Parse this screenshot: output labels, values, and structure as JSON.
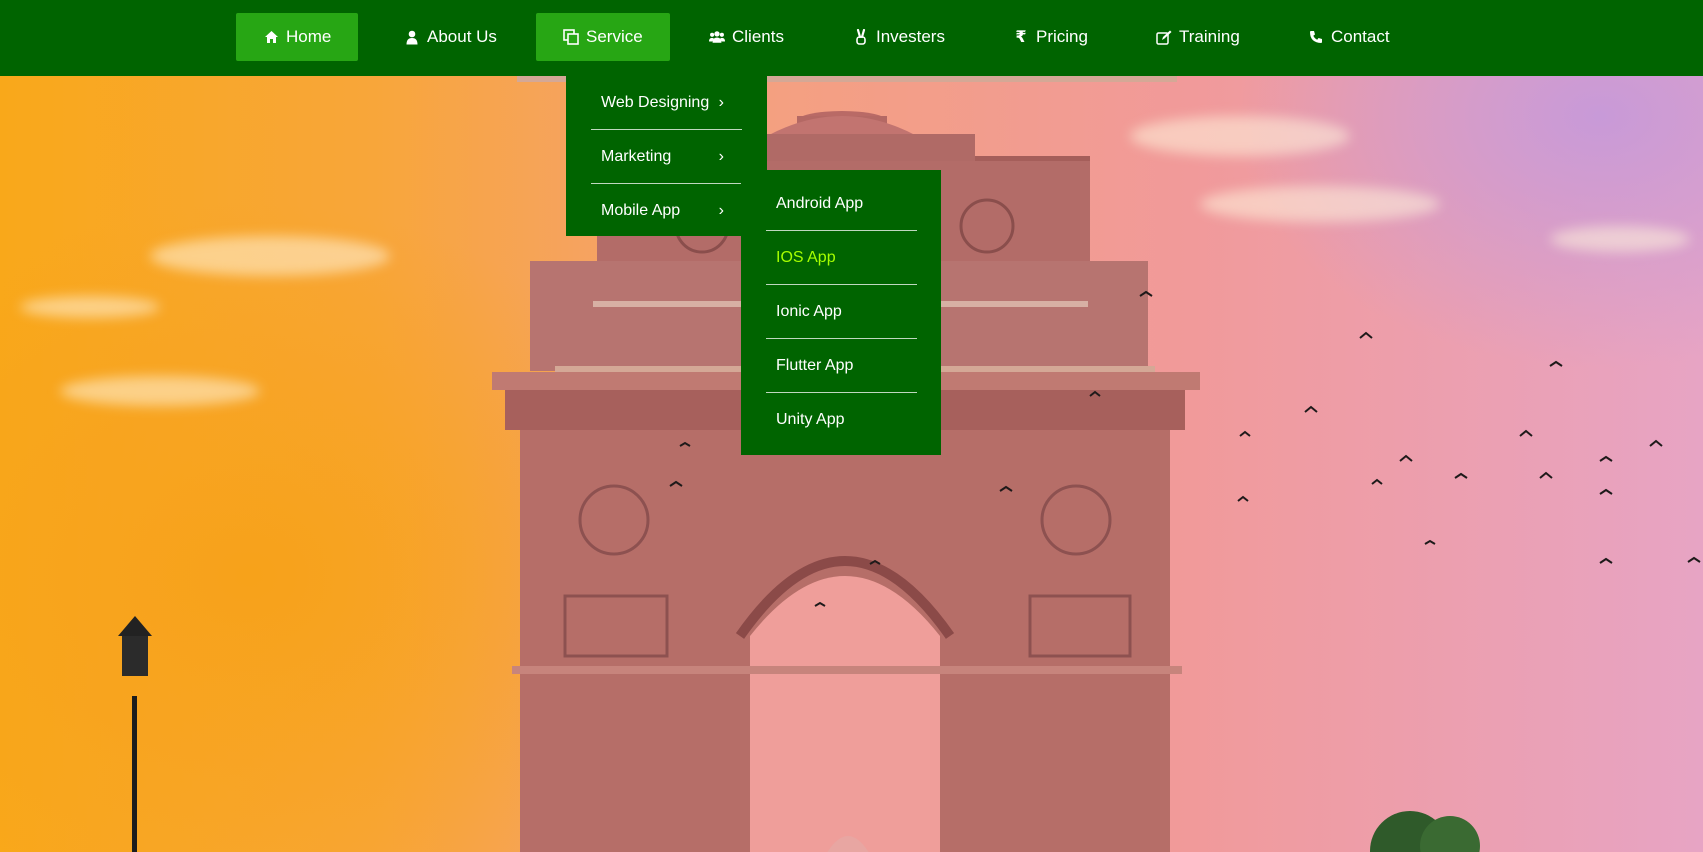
{
  "nav": {
    "items": [
      {
        "label": "Home",
        "icon": "home-icon"
      },
      {
        "label": "About Us",
        "icon": "user-icon"
      },
      {
        "label": "Service",
        "icon": "copy-icon"
      },
      {
        "label": "Clients",
        "icon": "users-icon"
      },
      {
        "label": "Investers",
        "icon": "hand-peace-icon"
      },
      {
        "label": "Pricing",
        "icon": "rupee-icon"
      },
      {
        "label": "Training",
        "icon": "edit-icon"
      },
      {
        "label": "Contact",
        "icon": "phone-icon"
      }
    ],
    "active_items": [
      "Home",
      "Service"
    ]
  },
  "service_menu": {
    "items": [
      {
        "label": "Web Designing"
      },
      {
        "label": "Marketing"
      },
      {
        "label": "Mobile App"
      }
    ]
  },
  "mobile_app_menu": {
    "items": [
      {
        "label": "Android App"
      },
      {
        "label": "IOS App"
      },
      {
        "label": "Ionic App"
      },
      {
        "label": "Flutter App"
      },
      {
        "label": "Unity App"
      }
    ],
    "highlighted": "IOS App"
  },
  "colors": {
    "nav_bg": "#006400",
    "nav_active": "#27a614",
    "submenu_highlight": "#a6ff00"
  }
}
